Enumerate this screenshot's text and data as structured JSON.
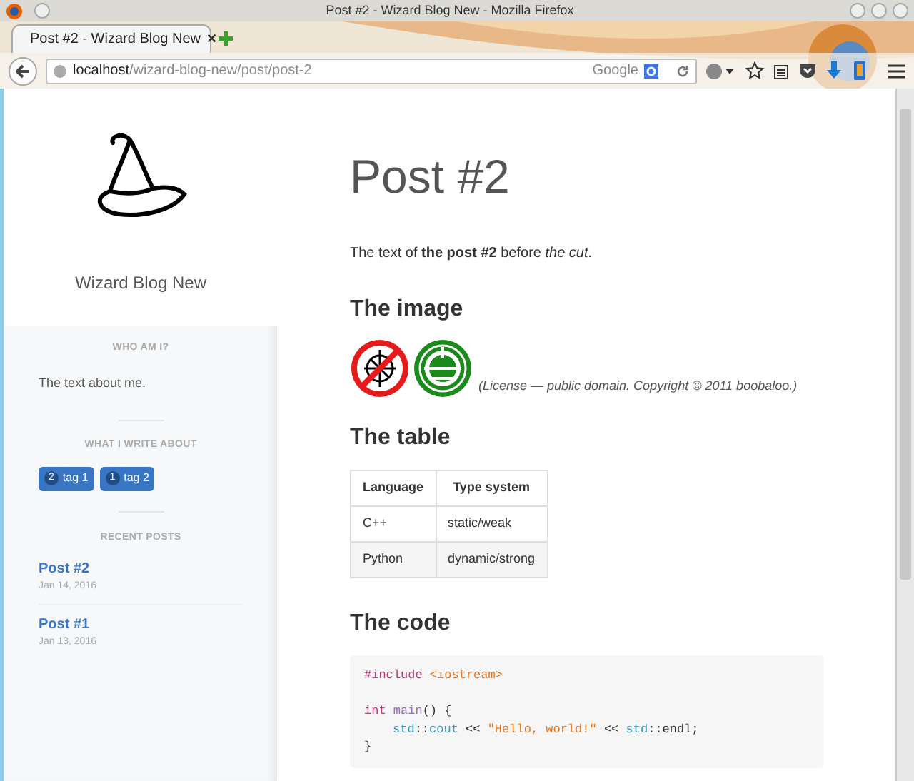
{
  "window": {
    "title": "Post #2 - Wizard Blog New - Mozilla Firefox"
  },
  "tabs": [
    {
      "label": "Post #2 - Wizard Blog New",
      "close": "✕",
      "selected": true
    }
  ],
  "address_bar": {
    "host": "localhost",
    "path": "/wizard-blog-new/post/post-2"
  },
  "search": {
    "engine": "Google"
  },
  "sidebar": {
    "blog_title": "Wizard Blog New",
    "about": {
      "heading": "WHO AM I?",
      "text": "The text about me."
    },
    "tags": {
      "heading": "WHAT I WRITE ABOUT",
      "items": [
        {
          "count": "2",
          "label": "tag 1"
        },
        {
          "count": "1",
          "label": "tag 2"
        }
      ]
    },
    "recent": {
      "heading": "RECENT POSTS",
      "items": [
        {
          "title": "Post #2",
          "date": "Jan 14, 2016"
        },
        {
          "title": "Post #1",
          "date": "Jan 13, 2016"
        }
      ]
    }
  },
  "post": {
    "title": "Post #2",
    "intro": "The text of **the post #2** before *the cut*.",
    "image_heading": "The image",
    "image_caption": "(License — public domain. Copyright © 2011 boobaloo.)",
    "table_heading": "The table",
    "table": {
      "columns": [
        "Language",
        "Type system"
      ],
      "rows": [
        [
          "C++",
          "static/weak"
        ],
        [
          "Python",
          "dynamic/strong"
        ]
      ]
    },
    "code_heading": "The code",
    "code": [
      {
        "tokens": [
          {
            "kind": "meta",
            "text": "#include"
          },
          {
            "kind": "string",
            "text": " <iostream>"
          }
        ]
      },
      {
        "kind": "blank"
      },
      {
        "tokens": [
          {
            "kind": "keyword",
            "text": "int"
          },
          {
            "kind": "func",
            "text": " main"
          },
          {
            "kind": "plain",
            "text": "() {"
          }
        ]
      },
      {
        "indented": true,
        "tokens": [
          {
            "kind": "builtin",
            "text": "std"
          },
          {
            "kind": "plain",
            "text": "::"
          },
          {
            "kind": "builtin",
            "text": "cout"
          },
          {
            "kind": "plain",
            "text": " << "
          },
          {
            "kind": "string",
            "text": "\"Hello, world!\""
          },
          {
            "kind": "plain",
            "text": " << "
          },
          {
            "kind": "builtin",
            "text": "std"
          },
          {
            "kind": "plain",
            "text": "::endl;"
          }
        ]
      },
      {
        "tokens": [
          {
            "kind": "plain",
            "text": "}"
          }
        ]
      }
    ]
  }
}
